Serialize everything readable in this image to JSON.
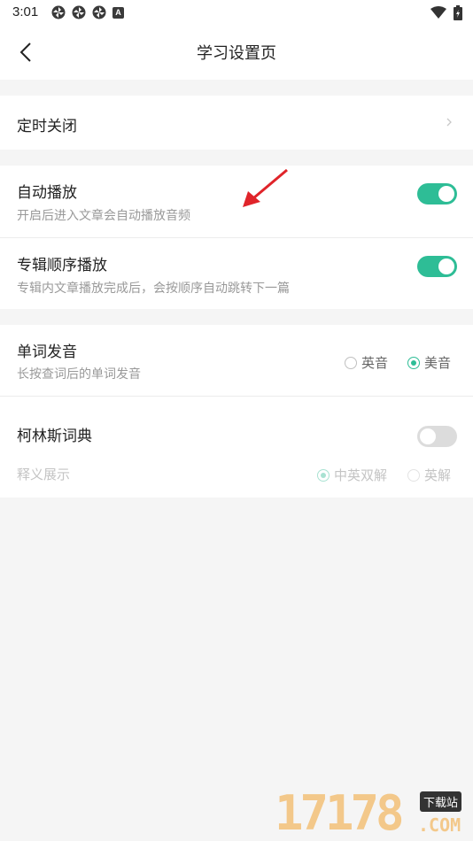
{
  "status_bar": {
    "time": "3:01",
    "notification_icons": [
      "pinwheel-icon",
      "pinwheel-icon",
      "pinwheel-icon",
      "a-icon"
    ],
    "a_icon_text": "A"
  },
  "header": {
    "title": "学习设置页"
  },
  "timer": {
    "label": "定时关闭"
  },
  "autoplay": {
    "title": "自动播放",
    "subtitle": "开启后进入文章会自动播放音频",
    "enabled": true
  },
  "album_order": {
    "title": "专辑顺序播放",
    "subtitle": "专辑内文章播放完成后，会按顺序自动跳转下一篇",
    "enabled": true
  },
  "pronunciation": {
    "title": "单词发音",
    "subtitle": "长按查词后的单词发音",
    "options": [
      "英音",
      "美音"
    ],
    "selected": "美音"
  },
  "collins": {
    "title": "柯林斯词典",
    "enabled": false,
    "display_label": "释义展示",
    "options": [
      "中英双解",
      "英解"
    ],
    "selected": "中英双解"
  },
  "colors": {
    "accent": "#2ebd96",
    "annotation_arrow": "#e0242a"
  },
  "watermark": {
    "number": "17178",
    "badge": "下载站",
    "domain": ".COM"
  }
}
